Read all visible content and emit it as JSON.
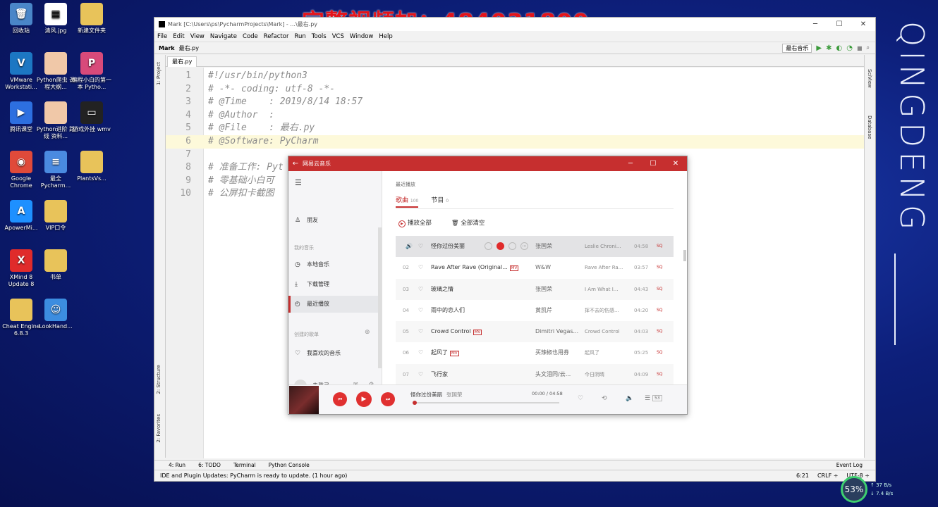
{
  "watermark": "完整视频加：484031800",
  "brand_vertical": "QINGDENG",
  "desktop": {
    "icons": [
      {
        "label": "回收站",
        "icon": "recycle-bin-icon",
        "color": "#4a86c8",
        "glyph": "🗑"
      },
      {
        "label": "清风.jpg",
        "icon": "qr-image-icon",
        "color": "#ffffff",
        "glyph": "▦"
      },
      {
        "label": "新建文件夹",
        "icon": "folder-icon",
        "color": "#e8c35a",
        "glyph": ""
      },
      {
        "label": "VMware Workstati...",
        "icon": "vmware-icon",
        "color": "#1c77c3",
        "glyph": "V"
      },
      {
        "label": "Python爬虫 课程大纲...",
        "icon": "file-icon",
        "color": "#f0c8a8",
        "glyph": ""
      },
      {
        "label": "编程小白的第一本 Pytho...",
        "icon": "book-icon",
        "color": "#d84a7a",
        "glyph": "P"
      },
      {
        "label": "腾讯课堂",
        "icon": "tencent-classroom-icon",
        "color": "#2d6fe0",
        "glyph": "▶"
      },
      {
        "label": "Python进阶 路线 资料...",
        "icon": "file-icon",
        "color": "#f0c8a8",
        "glyph": ""
      },
      {
        "label": "游戏外挂 wmv",
        "icon": "video-file-icon",
        "color": "#222222",
        "glyph": "▭"
      },
      {
        "label": "Google Chrome",
        "icon": "chrome-icon",
        "color": "#e04a3a",
        "glyph": "◉"
      },
      {
        "label": "最全 Pycharm...",
        "icon": "document-icon",
        "color": "#4a8ae0",
        "glyph": "≡"
      },
      {
        "label": "PlantsVs...",
        "icon": "folder-icon",
        "color": "#e8c35a",
        "glyph": ""
      },
      {
        "label": "ApowerMi...",
        "icon": "apowermirror-icon",
        "color": "#1e90ff",
        "glyph": "A"
      },
      {
        "label": "VIP口令",
        "icon": "folder-icon",
        "color": "#e8c35a",
        "glyph": ""
      },
      {
        "label": "XMind 8 Update 8",
        "icon": "xmind-icon",
        "color": "#e02b2b",
        "glyph": "X"
      },
      {
        "label": "书单",
        "icon": "folder-icon",
        "color": "#e8c35a",
        "glyph": ""
      },
      {
        "label": "Cheat Engine 6.8.3",
        "icon": "folder-icon",
        "color": "#e8c35a",
        "glyph": ""
      },
      {
        "label": "LookHand...",
        "icon": "ie-icon",
        "color": "#3c8de0",
        "glyph": "☺"
      }
    ]
  },
  "ide": {
    "title": "Mark [C:\\Users\\ps\\PycharmProjects\\Mark] - ...\\最右.py",
    "menu": [
      "File",
      "Edit",
      "View",
      "Navigate",
      "Code",
      "Refactor",
      "Run",
      "Tools",
      "VCS",
      "Window",
      "Help"
    ],
    "breadcrumb": [
      "Mark",
      "最右.py"
    ],
    "run_config": "最右音乐",
    "left_tools": [
      "1: Project",
      "2: Structure",
      "2: Favorites"
    ],
    "right_tools": [
      "SciView",
      "Database"
    ],
    "tab": "最右.py",
    "lines": [
      {
        "n": "1",
        "text": "#!/usr/bin/python3"
      },
      {
        "n": "2",
        "text": "# -*- coding: utf-8 -*-"
      },
      {
        "n": "3",
        "text": "# @Time    : 2019/8/14 18:57"
      },
      {
        "n": "4",
        "text": "# @Author  :"
      },
      {
        "n": "5",
        "text": "# @File    : 最右.py"
      },
      {
        "n": "6",
        "text": "# @Software: PyCharm"
      },
      {
        "n": "7",
        "text": ""
      },
      {
        "n": "8",
        "text": "# 准备工作: Pyt"
      },
      {
        "n": "9",
        "text": "# 零基础小白可"
      },
      {
        "n": "10",
        "text": "# 公屏扣卡截图"
      }
    ],
    "bottom_tools": [
      "4: Run",
      "6: TODO",
      "Terminal",
      "Python Console",
      "Event Log"
    ],
    "status": "IDE and Plugin Updates: PyCharm is ready to update. (1 hour ago)",
    "status_right": [
      "6:21",
      "CRLF ÷",
      "UTF-8 ÷"
    ]
  },
  "music": {
    "title": "网易云音乐",
    "side": {
      "friends": "朋友",
      "my_music": "我的音乐",
      "local": "本地音乐",
      "downloads": "下载管理",
      "recent": "最近播放",
      "created": "创建的歌单",
      "liked": "我喜欢的音乐",
      "login": "未登录"
    },
    "subhead": "最近播放",
    "tab_songs": "歌曲",
    "tab_songs_count": "100",
    "tab_programs": "节目",
    "tab_programs_count": "0",
    "play_all": "播放全部",
    "clear_all": "全部清空",
    "rows": [
      {
        "idx": "",
        "name": "怪你过份美丽",
        "mv": false,
        "artist": "张国荣",
        "album": "Leslie Chroni...",
        "dur": "04:58",
        "playing": true
      },
      {
        "idx": "02",
        "name": "Rave After Rave (Original...",
        "mv": true,
        "artist": "W&W",
        "album": "Rave After Ra...",
        "dur": "03:57"
      },
      {
        "idx": "03",
        "name": "玻璃之情",
        "mv": false,
        "artist": "张国荣",
        "album": "I Am What I...",
        "dur": "04:43"
      },
      {
        "idx": "04",
        "name": "雨中的恋人们",
        "mv": false,
        "artist": "黄凯芹",
        "album": "挥不去的伤感...",
        "dur": "04:20"
      },
      {
        "idx": "05",
        "name": "Crowd Control",
        "mv": true,
        "artist": "Dimitri Vegas...",
        "album": "Crowd Control",
        "dur": "04:03"
      },
      {
        "idx": "06",
        "name": "起风了",
        "mv": true,
        "artist": "买辣椒也用券",
        "album": "起风了",
        "dur": "05:25"
      },
      {
        "idx": "07",
        "name": "飞行家",
        "mv": false,
        "artist": "头文泪同/云...",
        "album": "今日阴晴",
        "dur": "04:09"
      }
    ],
    "mv_label": "MV",
    "sq_label": "SQ",
    "player": {
      "song": "怪你过份美丽",
      "artist": "张国荣",
      "time": "00:00 / 04:58",
      "progress": 0,
      "count": "53"
    }
  },
  "system": {
    "perf": "53%",
    "net_up": "37 B/s",
    "net_down": "7.4 B/s"
  }
}
